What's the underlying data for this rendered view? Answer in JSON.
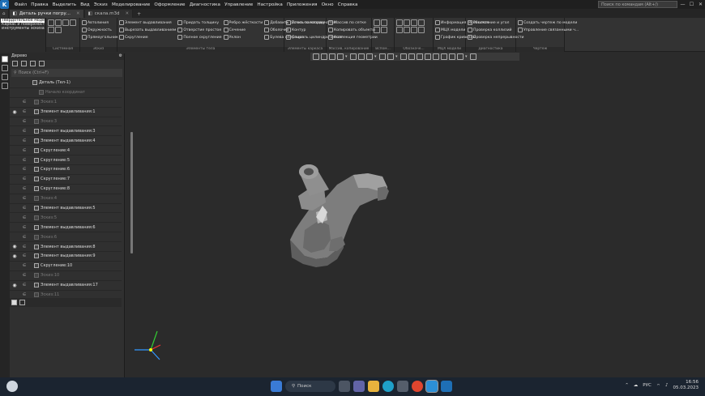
{
  "titlebar": {
    "menu": [
      "Файл",
      "Правка",
      "Выделить",
      "Вид",
      "Эскиз",
      "Моделирование",
      "Оформление",
      "Диагностика",
      "Управление",
      "Настройка",
      "Приложения",
      "Окно",
      "Справка"
    ],
    "search_placeholder": "Поиск по командам (Alt+/)"
  },
  "tabs": [
    {
      "label": "Деталь ручки погру...",
      "active": true
    },
    {
      "label": "скала.m3d",
      "active": false
    }
  ],
  "modes": [
    "Твердотельное моделирование",
    "Каркас и поверхности",
    "Инструменты эскиза"
  ],
  "ribbon_groups": [
    {
      "label": "Системная",
      "buttons": []
    },
    {
      "label": "Эскиз",
      "buttons": [
        "Автолиния",
        "Окружность",
        "Прямоугольник"
      ]
    },
    {
      "label": "Элементы тела",
      "buttons": [
        "Элемент выдавливания",
        "Вырезать выдавливанием",
        "Скругление",
        "Придать толщину",
        "Отверстие простое",
        "Полное скругление",
        "Ребро жёсткости",
        "Сечение",
        "Уклон",
        "Добавить деталь-заготовку",
        "Оболочка",
        "Булева операция"
      ]
    },
    {
      "label": "Элементы каркаса",
      "buttons": [
        "Точка по координатам",
        "Контур",
        "Спираль цилиндрическая"
      ]
    },
    {
      "label": "Массив, копирование",
      "buttons": [
        "Массив по сетке",
        "Копировать объекты",
        "Коллекция геометрии"
      ]
    },
    {
      "label": "Вспом...",
      "buttons": []
    },
    {
      "label": "Обозначе...",
      "buttons": []
    },
    {
      "label": "МЦХ модели",
      "buttons": [
        "Информация об объекте",
        "МЦХ модели",
        "График кривизны"
      ]
    },
    {
      "label": "Диагностика",
      "buttons": [
        "Расстояние и угол",
        "Проверка коллизий",
        "Проверка непрерывности"
      ]
    },
    {
      "label": "Чертеж",
      "buttons": [
        "Создать чертеж по модели",
        "Управление связанными ч..."
      ]
    }
  ],
  "panel": {
    "title": "Дерево",
    "search_placeholder": "Поиск (Ctrl+F)",
    "tree": [
      {
        "label": "Деталь (Тел-1)",
        "eye": false,
        "dim": false,
        "indent": 1
      },
      {
        "label": "Начало координат",
        "eye": false,
        "dim": true,
        "indent": 2
      },
      {
        "label": "Эскиз:1",
        "eye": false,
        "dim": true,
        "indent": 1
      },
      {
        "label": "Элемент выдавливания:1",
        "eye": true,
        "dim": false,
        "indent": 1
      },
      {
        "label": "Эскиз:3",
        "eye": false,
        "dim": true,
        "indent": 1
      },
      {
        "label": "Элемент выдавливания:3",
        "eye": false,
        "dim": false,
        "indent": 1
      },
      {
        "label": "Элемент выдавливания:4",
        "eye": false,
        "dim": false,
        "indent": 1
      },
      {
        "label": "Скругление:4",
        "eye": false,
        "dim": false,
        "indent": 1
      },
      {
        "label": "Скругление:5",
        "eye": false,
        "dim": false,
        "indent": 1
      },
      {
        "label": "Скругление:6",
        "eye": false,
        "dim": false,
        "indent": 1
      },
      {
        "label": "Скругление:7",
        "eye": false,
        "dim": false,
        "indent": 1
      },
      {
        "label": "Скругление:8",
        "eye": false,
        "dim": false,
        "indent": 1
      },
      {
        "label": "Эскиз:4",
        "eye": false,
        "dim": true,
        "indent": 1
      },
      {
        "label": "Элемент выдавливания:5",
        "eye": false,
        "dim": false,
        "indent": 1
      },
      {
        "label": "Эскиз:5",
        "eye": false,
        "dim": true,
        "indent": 1
      },
      {
        "label": "Элемент выдавливания:6",
        "eye": false,
        "dim": false,
        "indent": 1
      },
      {
        "label": "Эскиз:6",
        "eye": false,
        "dim": true,
        "indent": 1
      },
      {
        "label": "Элемент выдавливания:8",
        "eye": true,
        "dim": false,
        "indent": 1
      },
      {
        "label": "Элемент выдавливания:9",
        "eye": true,
        "dim": false,
        "indent": 1
      },
      {
        "label": "Скругление:10",
        "eye": false,
        "dim": false,
        "indent": 1
      },
      {
        "label": "Эскиз:10",
        "eye": false,
        "dim": true,
        "indent": 1
      },
      {
        "label": "Элемент выдавливания:17",
        "eye": true,
        "dim": false,
        "indent": 1
      },
      {
        "label": "Эскиз:11",
        "eye": false,
        "dim": true,
        "indent": 1
      }
    ]
  },
  "taskbar": {
    "search_label": "Поиск",
    "lang": "РУС",
    "time": "16:56",
    "date": "05.03.2023"
  },
  "colors": {
    "accent": "#1e6fb5",
    "viewport_bg": "#2b2b2b",
    "part": "#8e8e8e"
  }
}
